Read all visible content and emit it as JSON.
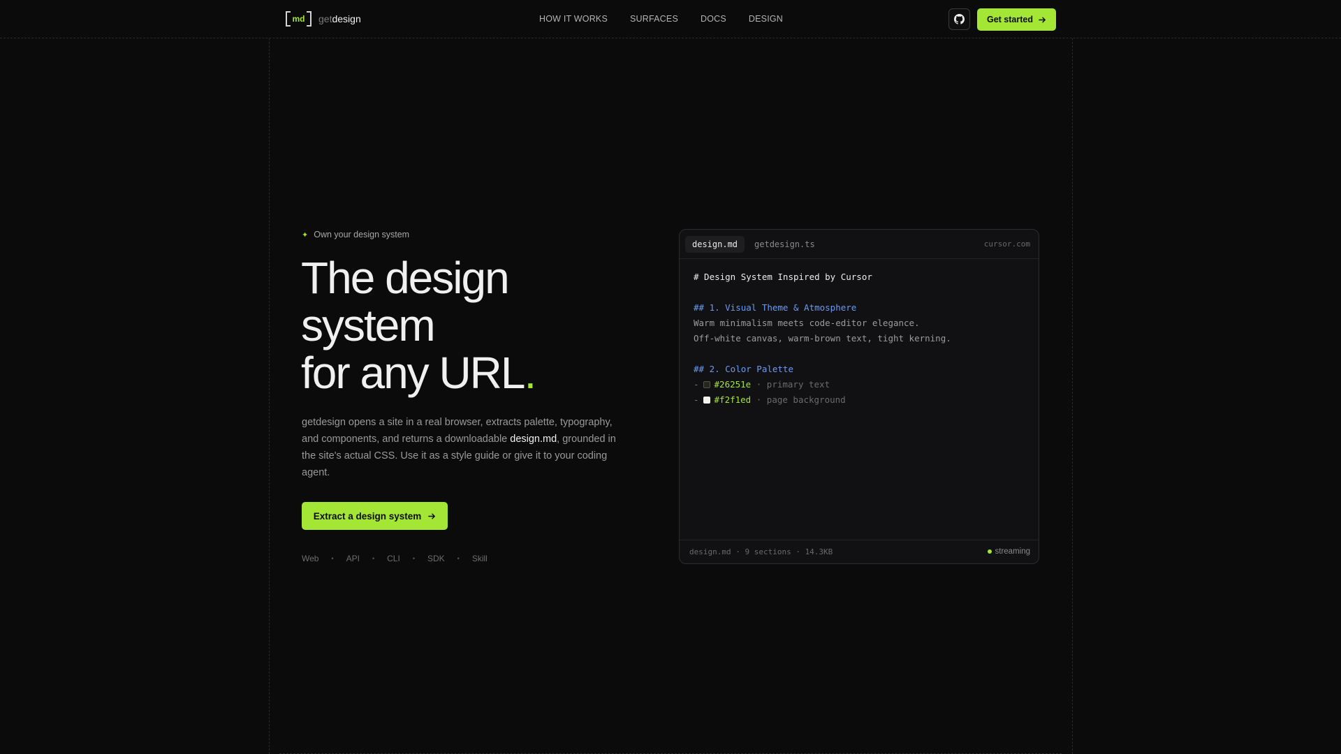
{
  "brand": {
    "mark": "md",
    "name_prefix": "get",
    "name_suffix": "design",
    "accent": "#a3e635"
  },
  "nav": {
    "links": [
      "HOW IT WORKS",
      "SURFACES",
      "DOCS",
      "DESIGN"
    ],
    "github_icon": "github-icon",
    "cta_label": "Get started"
  },
  "hero": {
    "eyebrow": "Own your design system",
    "headline_lines": [
      "The design",
      "system",
      "for any URL"
    ],
    "headline_dot": ".",
    "desc_before": "getdesign opens a site in a real browser, extracts palette, typography, and components, and returns a downloadable ",
    "desc_highlight": "design.md",
    "desc_after": ", grounded in the site's actual CSS. Use it as a style guide or give it to your coding agent.",
    "cta_label": "Extract a design system",
    "surfaces": [
      "Web",
      "API",
      "CLI",
      "SDK",
      "Skill"
    ]
  },
  "panel": {
    "tabs": [
      "design.md",
      "getdesign.ts"
    ],
    "source": "cursor.com",
    "code": {
      "h1": "# Design System Inspired by Cursor",
      "h2_1": "## 1. Visual Theme & Atmosphere",
      "p1": "Warm minimalism meets code-editor elegance.",
      "p2": "Off-white canvas, warm-brown text, tight kerning.",
      "h2_2": "## 2. Color Palette",
      "colors": [
        {
          "dash": "-",
          "hex": "#26251e",
          "note": "· primary text"
        },
        {
          "dash": "-",
          "hex": "#f2f1ed",
          "note": "· page background"
        }
      ]
    },
    "footer": "design.md · 9 sections · 14.3KB",
    "status": "streaming"
  }
}
